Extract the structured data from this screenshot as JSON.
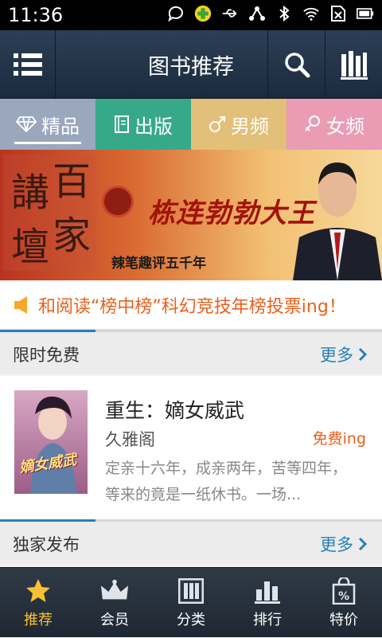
{
  "status_bar": {
    "time": "11:36"
  },
  "header": {
    "title": "图书推荐"
  },
  "tabs": [
    {
      "label": "精品",
      "icon": "diamond-icon"
    },
    {
      "label": "出版",
      "icon": "book-icon"
    },
    {
      "label": "男频",
      "icon": "male-icon"
    },
    {
      "label": "女频",
      "icon": "female-icon"
    }
  ],
  "banner": {
    "logo_text": "百家講壇",
    "headline": "栋连勃勃大王",
    "subtitle": "辣笔趣评五千年"
  },
  "notice": {
    "text": "和阅读“榜中榜”科幻竞技年榜投票ing！"
  },
  "sections": [
    {
      "title": "限时免费",
      "more": "更多"
    },
    {
      "title": "独家发布",
      "more": "更多"
    }
  ],
  "book": {
    "title": "重生：嫡女威武",
    "author": "久雅阁",
    "badge": "免费ing",
    "description": "定亲十六年，成亲两年，苦等四年，等来的竟是一纸休书。一场...",
    "cover_text": "嫡女威武"
  },
  "bottom_nav": [
    {
      "label": "推荐",
      "icon": "star-icon"
    },
    {
      "label": "会员",
      "icon": "crown-icon"
    },
    {
      "label": "分类",
      "icon": "category-icon"
    },
    {
      "label": "排行",
      "icon": "ranking-icon"
    },
    {
      "label": "特价",
      "icon": "discount-bag-icon"
    }
  ],
  "colors": {
    "accent": "#2a7fb5",
    "notice": "#e8601c",
    "nav_active": "#f7c035"
  }
}
